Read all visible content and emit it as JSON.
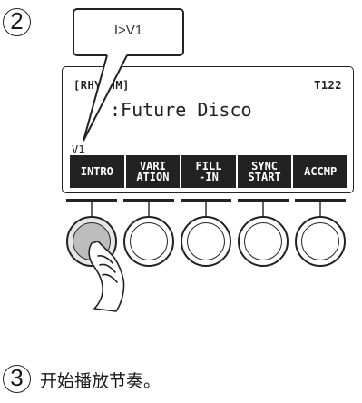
{
  "steps": {
    "step2_number": "2",
    "step3_number": "3",
    "step3_text": "开始播放节奏。"
  },
  "callout": {
    "text": "I>V1"
  },
  "lcd": {
    "rhythm_label": "[RHYTHM]",
    "tempo": "T122",
    "rhythm_name": ":Future Disco",
    "variation": "V1",
    "softkeys": [
      {
        "line1": "INTRO",
        "line2": ""
      },
      {
        "line1": "VARI",
        "line2": "ATION"
      },
      {
        "line1": "FILL",
        "line2": "-IN"
      },
      {
        "line1": "SYNC",
        "line2": "START"
      },
      {
        "line1": "ACCMP",
        "line2": ""
      }
    ]
  },
  "buttons": {
    "count": 5,
    "pressed_index": 0
  },
  "icons": {
    "hand": "pointing-hand-icon"
  },
  "colors": {
    "ink": "#222222",
    "pressed_fill": "#bdbdbd",
    "lcd_bar": "#222222"
  }
}
